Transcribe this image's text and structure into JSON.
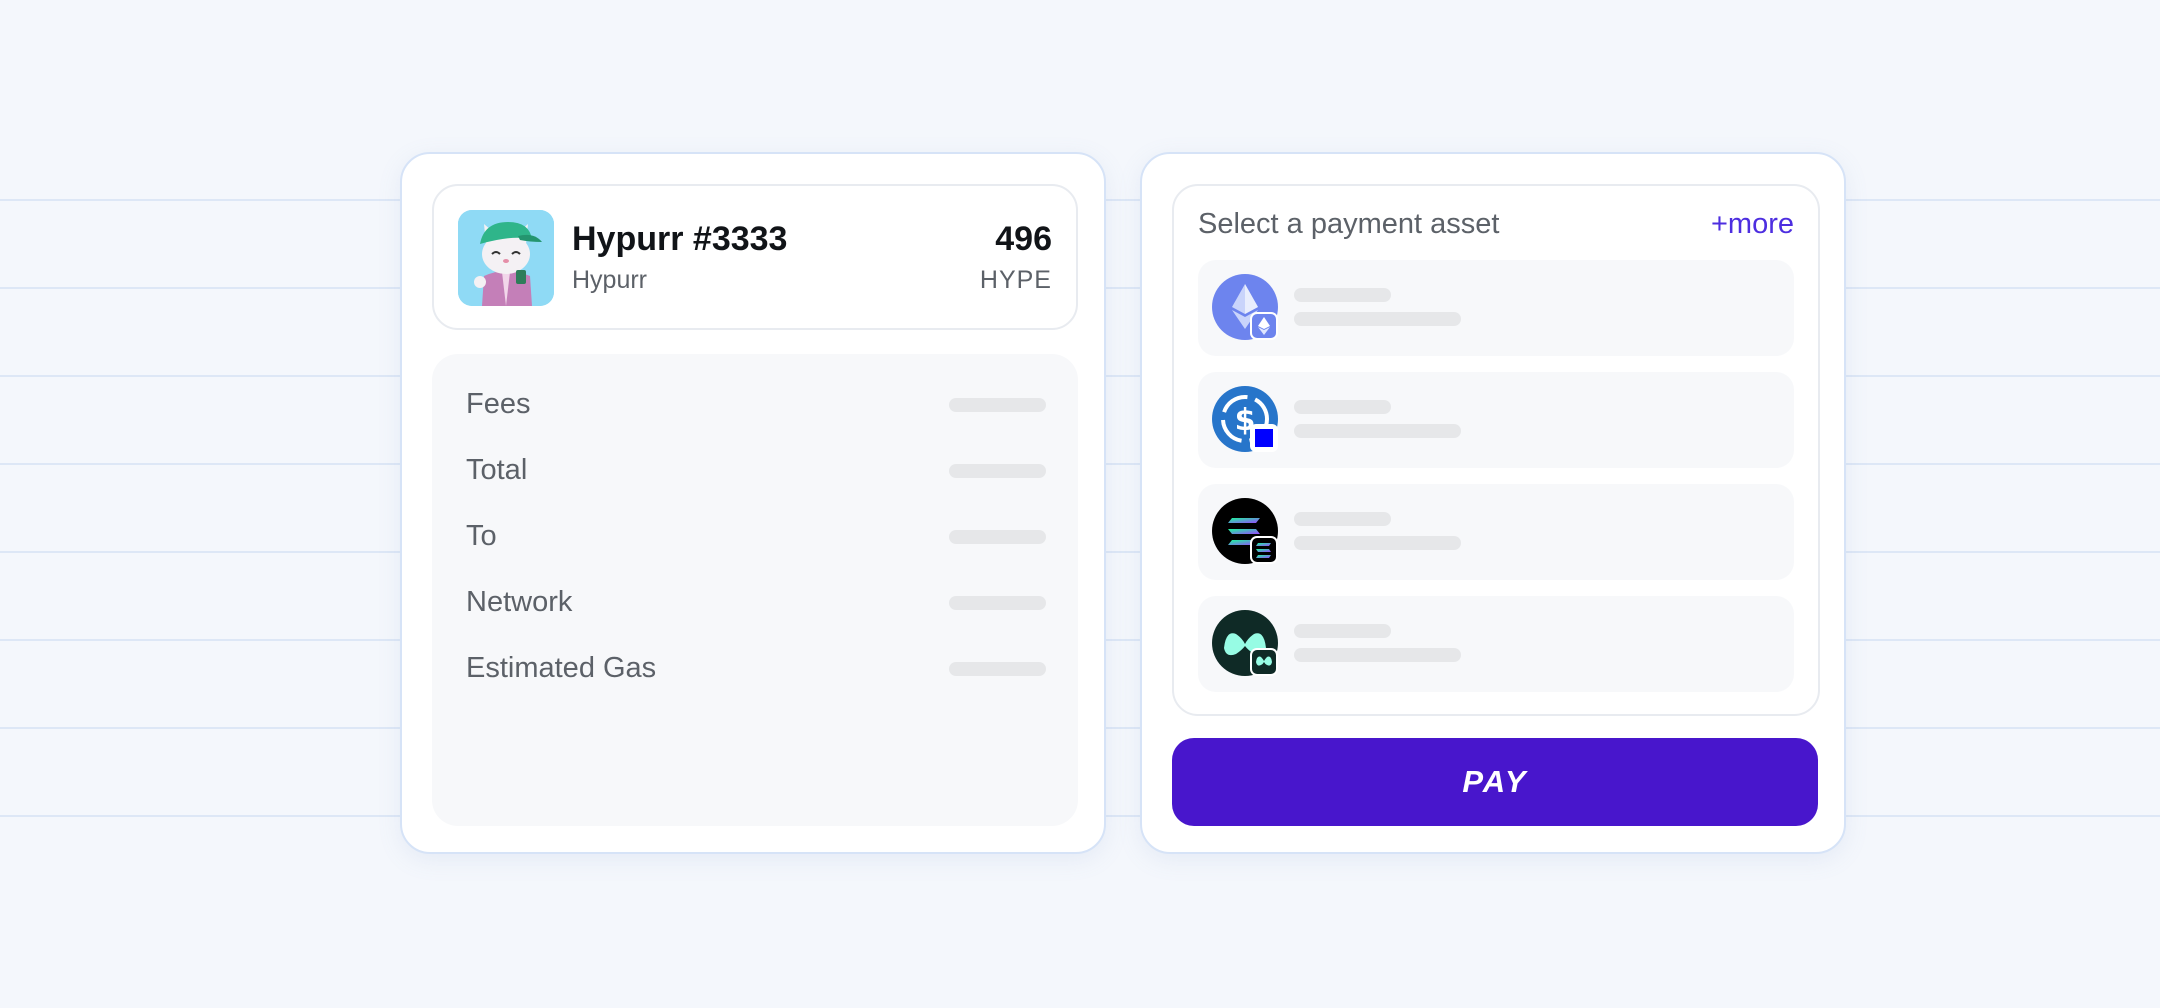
{
  "colors": {
    "accent": "#4816cc",
    "link": "#4d2ee0",
    "background": "#f4f7fc",
    "skeleton": "#e6e7e9"
  },
  "order": {
    "item_name": "Hypurr #3333",
    "collection": "Hypurr",
    "price": "496",
    "currency": "HYPE",
    "image": "cat-nft-thumbnail"
  },
  "details": {
    "rows": [
      {
        "label": "Fees",
        "value_state": "loading"
      },
      {
        "label": "Total",
        "value_state": "loading"
      },
      {
        "label": "To",
        "value_state": "loading"
      },
      {
        "label": "Network",
        "value_state": "loading"
      },
      {
        "label": "Estimated Gas",
        "value_state": "loading"
      }
    ]
  },
  "payment": {
    "header": "Select a payment asset",
    "more_link": "+more",
    "assets": [
      {
        "icon": "ethereum-icon",
        "chain_badge": "ethereum-badge-icon",
        "state": "loading"
      },
      {
        "icon": "usdc-icon",
        "chain_badge": "square-badge-icon",
        "state": "loading"
      },
      {
        "icon": "solana-icon",
        "chain_badge": "solana-badge-icon",
        "state": "loading"
      },
      {
        "icon": "hyperliquid-icon",
        "chain_badge": "hyperliquid-badge-icon",
        "state": "loading"
      }
    ],
    "pay_label": "PAY"
  }
}
